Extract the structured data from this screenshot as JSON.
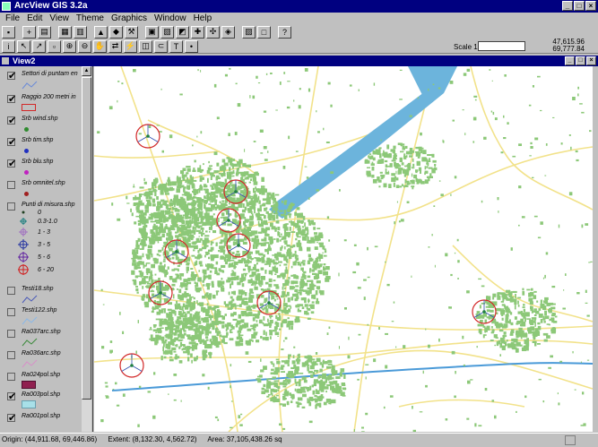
{
  "app": {
    "title": "ArcView GIS 3.2a"
  },
  "menu": [
    "File",
    "Edit",
    "View",
    "Theme",
    "Graphics",
    "Window",
    "Help"
  ],
  "scale": {
    "label": "Scale 1:",
    "value": ""
  },
  "coords": {
    "x": "47,615.96",
    "y": "69,777.84"
  },
  "view": {
    "title": "View2"
  },
  "layers": [
    {
      "name": "Settori di puntam en",
      "checked": true,
      "symbol": "line-blue"
    },
    {
      "name": "Raggio 200 metri in",
      "checked": true,
      "symbol": "rect-red-outline"
    },
    {
      "name": "Srb wind.shp",
      "checked": true,
      "symbol": "dot-green"
    },
    {
      "name": "Srb tim.shp",
      "checked": true,
      "symbol": "dot-blue"
    },
    {
      "name": "Srb blu.shp",
      "checked": true,
      "symbol": "dot-magenta"
    },
    {
      "name": "Srb omnitel.shp",
      "checked": false,
      "symbol": "dot-darkred"
    },
    {
      "name": "Punti di misura.shp",
      "checked": false,
      "symbol": "legend-classes",
      "classes": [
        "0",
        "0.3-1.0",
        "1 - 3",
        "3 - 5",
        "5 - 6",
        "6 - 20"
      ]
    },
    {
      "name": "Testi18.shp",
      "checked": false,
      "symbol": "line-blue"
    },
    {
      "name": "Testi122.shp",
      "checked": false,
      "symbol": "line-lightblue"
    },
    {
      "name": "Ra037arc.shp",
      "checked": false,
      "symbol": "line-green"
    },
    {
      "name": "Ra036arc.shp",
      "checked": false,
      "symbol": "line-pink"
    },
    {
      "name": "Ra024pol.shp",
      "checked": false,
      "symbol": "fill-maroon"
    },
    {
      "name": "Ra003pol.shp",
      "checked": true,
      "symbol": "fill-cyan"
    },
    {
      "name": "Ra001pol.shp",
      "checked": true,
      "symbol": "fill-gray"
    }
  ],
  "status": {
    "origin": "Origin: (44,911.68, 69,446.86)",
    "extent": "Extent: (8,132.30, 4,562.72)",
    "area": "Area: 37,105,438.26 sq"
  },
  "colors": {
    "titlebar": "#000080",
    "road": "#f5e68c",
    "building": "#8cc878",
    "water": "#6cb4dc",
    "circle": "#d22828"
  }
}
